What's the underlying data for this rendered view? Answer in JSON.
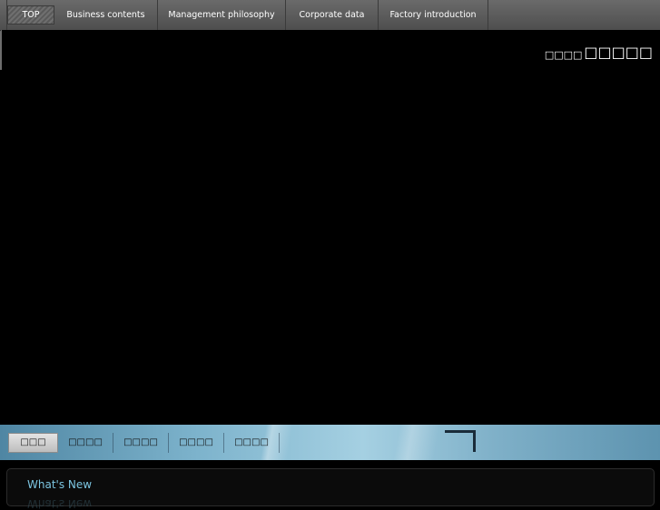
{
  "topnav": {
    "items": [
      {
        "label": "TOP",
        "active": true
      },
      {
        "label": "Business contents",
        "active": false
      },
      {
        "label": "Management philosophy",
        "active": false
      },
      {
        "label": "Corporate data",
        "active": false
      },
      {
        "label": "Factory introduction",
        "active": false
      }
    ]
  },
  "hero": {
    "title_small": "□□□□",
    "title_large": "□□□□□"
  },
  "subnav": {
    "items": [
      {
        "label": "□□□",
        "active": true
      },
      {
        "label": "□□□□",
        "active": false
      },
      {
        "label": "□□□□",
        "active": false
      },
      {
        "label": "□□□□",
        "active": false
      },
      {
        "label": "□□□□",
        "active": false
      }
    ]
  },
  "news": {
    "title": "What's New"
  },
  "colors": {
    "accent": "#7cc6e2",
    "nav_bg": "#5c5c5c",
    "banner": "#8ec2d8"
  }
}
